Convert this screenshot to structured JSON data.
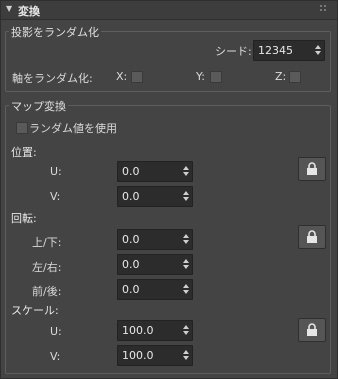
{
  "panel": {
    "title": "変換"
  },
  "projection_group": {
    "title": "投影をランダム化",
    "seed_label": "シード:",
    "seed_value": "12345",
    "axis_label": "軸をランダム化:",
    "x_label": "X:",
    "y_label": "Y:",
    "z_label": "Z:"
  },
  "map_group": {
    "title": "マップ変換",
    "random_value_label": "ランダム値を使用",
    "position": {
      "label": "位置:",
      "u_label": "U:",
      "u_value": "0.0",
      "v_label": "V:",
      "v_value": "0.0"
    },
    "rotation": {
      "label": "回転:",
      "updown_label": "上/下:",
      "updown_value": "0.0",
      "leftright_label": "左/右:",
      "leftright_value": "0.0",
      "frontback_label": "前/後:",
      "frontback_value": "0.0"
    },
    "scale": {
      "label": "スケール:",
      "u_label": "U:",
      "u_value": "100.0",
      "v_label": "V:",
      "v_value": "100.0"
    }
  },
  "icons": {
    "collapse": "triangle-down-icon",
    "grip": "grip-dots-icon",
    "lock": "lock-icon"
  }
}
